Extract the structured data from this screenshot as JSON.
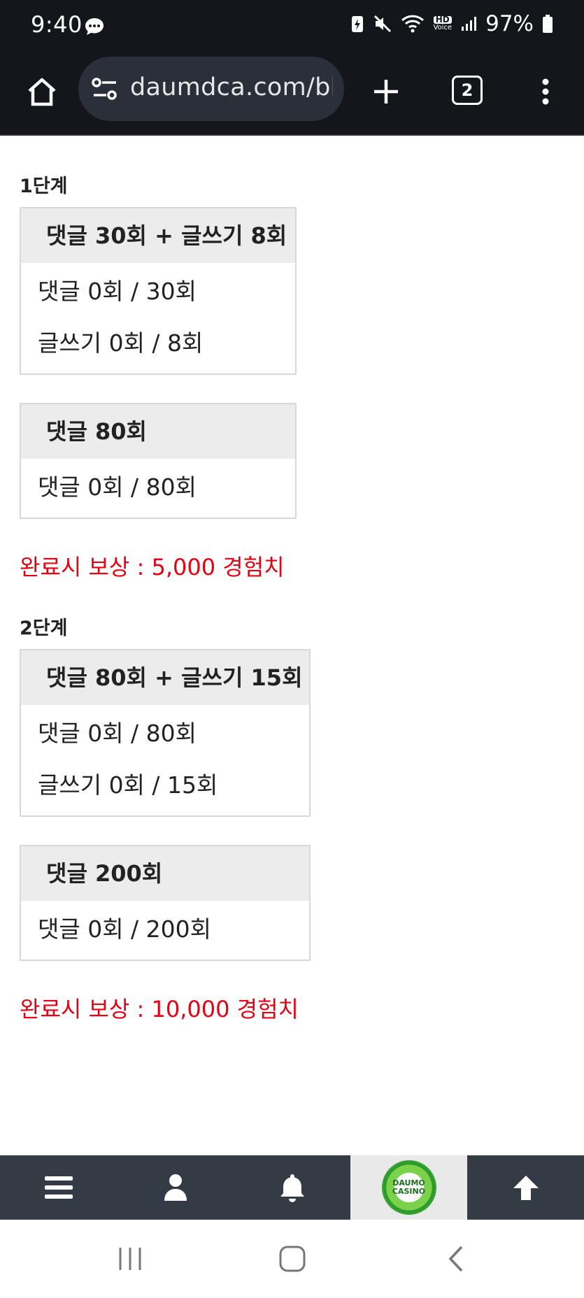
{
  "status_bar": {
    "time": "9:40",
    "battery": "97%",
    "hd_label": "HD",
    "voice_label": "Voice"
  },
  "browser": {
    "url": "daumdca.com/bb",
    "tab_count": "2"
  },
  "stages": [
    {
      "title": "1단계",
      "cards": [
        {
          "header": "댓글 30회 + 글쓰기 8회",
          "rows": [
            "댓글 0회 / 30회",
            "글쓰기 0회 / 8회"
          ]
        },
        {
          "header": "댓글 80회",
          "rows": [
            "댓글 0회 / 80회"
          ]
        }
      ],
      "reward": "완료시 보상 : 5,000 경험치"
    },
    {
      "title": "2단계",
      "cards": [
        {
          "header": "댓글 80회 + 글쓰기 15회",
          "rows": [
            "댓글 0회 / 80회",
            "글쓰기 0회 / 15회"
          ]
        },
        {
          "header": "댓글 200회",
          "rows": [
            "댓글 0회 / 200회"
          ]
        }
      ],
      "reward": "완료시 보상 : 10,000 경험치"
    }
  ],
  "bottom_nav": {
    "items": [
      "menu-icon",
      "user-icon",
      "bell-icon",
      "logo",
      "arrow-up-icon"
    ],
    "logo_text": [
      "DAUMO",
      "CASINO"
    ]
  },
  "colors": {
    "reward_red": "#e60012",
    "bar_dark": "#14161b",
    "nav_dark": "#353b45"
  }
}
